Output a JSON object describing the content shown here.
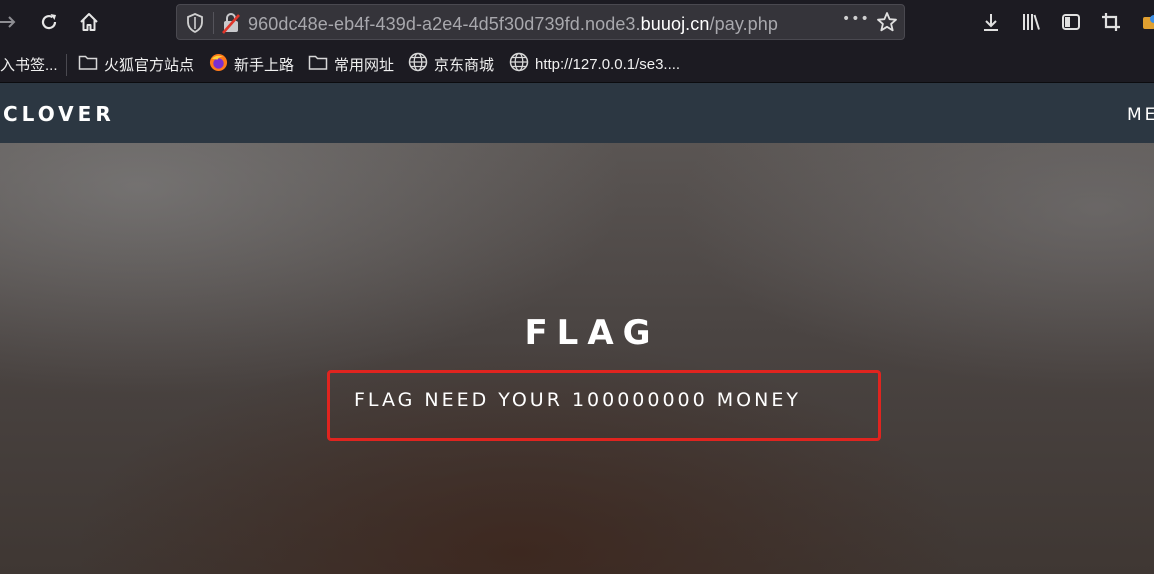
{
  "browser": {
    "url_prefix": "960dc48e-eb4f-439d-a2e4-4d5f30d739fd.node3.",
    "url_domain": "buuoj.cn",
    "url_path": "/pay.php",
    "more_glyph": "•••"
  },
  "bookmarks": [
    {
      "label": "入书签...",
      "icon": "none"
    },
    {
      "label": "火狐官方站点",
      "icon": "folder-icon"
    },
    {
      "label": "新手上路",
      "icon": "firefox-icon"
    },
    {
      "label": "常用网址",
      "icon": "folder-icon"
    },
    {
      "label": "京东商城",
      "icon": "globe-icon"
    },
    {
      "label": "http://127.0.0.1/se3....",
      "icon": "globe-icon"
    }
  ],
  "site": {
    "brand": "CLOVER",
    "menu": "ME"
  },
  "hero": {
    "title": "FLAG",
    "message": "FLAG NEED YOUR 100000000 MONEY",
    "highlight_color": "#e0241f"
  }
}
